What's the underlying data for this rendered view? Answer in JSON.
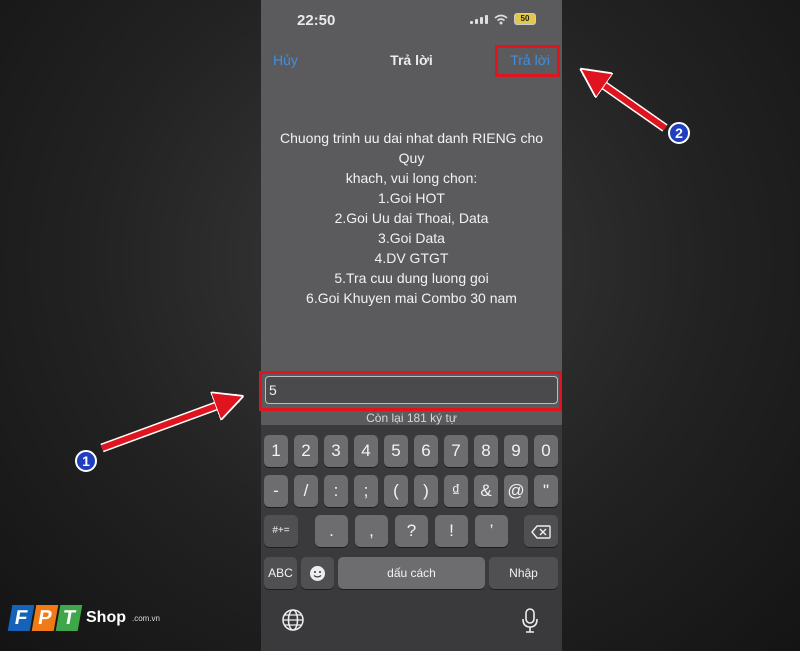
{
  "status_bar": {
    "time": "22:50",
    "battery": "50"
  },
  "nav": {
    "cancel": "Hủy",
    "title": "Trả lời",
    "reply": "Trả lời"
  },
  "message_lines": [
    "Chuong trinh uu dai nhat danh RIENG cho",
    "Quy",
    "khach, vui long chon:",
    "1.Goi HOT",
    "2.Goi Uu dai Thoai, Data",
    "3.Goi Data",
    "4.DV GTGT",
    "5.Tra cuu dung luong goi",
    "6.Goi Khuyen mai Combo 30 nam"
  ],
  "input": {
    "value": "5"
  },
  "counter": "Còn lại 181 ký tự",
  "keyboard": {
    "row1": [
      "1",
      "2",
      "3",
      "4",
      "5",
      "6",
      "7",
      "8",
      "9",
      "0"
    ],
    "row2": [
      "-",
      "/",
      ":",
      ";",
      "(",
      ")",
      "₫",
      "&",
      "@",
      "\""
    ],
    "row3_mode": "#+=",
    "row3": [
      ".",
      ",",
      "?",
      "!",
      "’"
    ],
    "abc": "ABC",
    "space": "dấu cách",
    "return": "Nhập"
  },
  "annotations": {
    "marker1": "1",
    "marker2": "2",
    "accent": "#e0141f",
    "marker_color": "#1f3fbf"
  },
  "brand": {
    "letters": [
      "F",
      "P",
      "T"
    ],
    "name": "Shop",
    "domain": ".com.vn"
  }
}
